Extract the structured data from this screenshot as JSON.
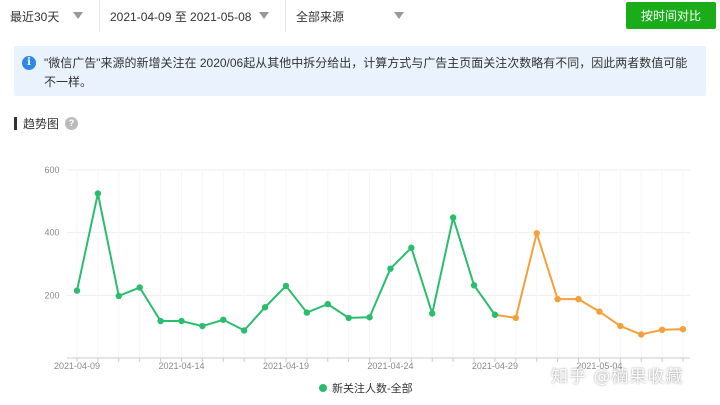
{
  "toolbar": {
    "range_select": "最近30天",
    "date_range": "2021-04-09 至 2021-05-08",
    "source_select": "全部来源",
    "compare_button": "按时间对比"
  },
  "notice": {
    "text": "\"微信广告\"来源的新增关注在 2020/06起从其他中拆分给出，计算方式与广告主页面关注次数略有不同，因此两者数值可能不一样。"
  },
  "section": {
    "title": "趋势图"
  },
  "watermark": "知乎 @楠果收藏",
  "colors": {
    "accent": "#1aad19",
    "series": "#2bbd6e",
    "highlight": "#f5a03c",
    "info": "#2f87e6"
  },
  "chart_data": {
    "type": "line",
    "ylim": [
      0,
      600
    ],
    "yticks": [
      200,
      400,
      600
    ],
    "x_tick_labels": [
      "2021-04-09",
      "2021-04-14",
      "2021-04-19",
      "2021-04-24",
      "2021-04-29",
      "2021-05-04"
    ],
    "x": [
      "2021-04-09",
      "2021-04-10",
      "2021-04-11",
      "2021-04-12",
      "2021-04-13",
      "2021-04-14",
      "2021-04-15",
      "2021-04-16",
      "2021-04-17",
      "2021-04-18",
      "2021-04-19",
      "2021-04-20",
      "2021-04-21",
      "2021-04-22",
      "2021-04-23",
      "2021-04-24",
      "2021-04-25",
      "2021-04-26",
      "2021-04-27",
      "2021-04-28",
      "2021-04-29",
      "2021-04-30",
      "2021-05-01",
      "2021-05-02",
      "2021-05-03",
      "2021-05-04",
      "2021-05-05",
      "2021-05-06",
      "2021-05-07",
      "2021-05-08"
    ],
    "series": [
      {
        "name": "新关注人数-全部",
        "values": [
          215,
          525,
          198,
          225,
          118,
          118,
          102,
          122,
          88,
          162,
          230,
          145,
          172,
          128,
          130,
          285,
          352,
          142,
          448,
          232,
          138,
          128,
          398,
          188,
          188,
          148,
          102,
          75,
          90,
          92
        ],
        "highlighted_from": "2021-04-30"
      }
    ],
    "legend_position": "bottom-center",
    "grid": true
  }
}
